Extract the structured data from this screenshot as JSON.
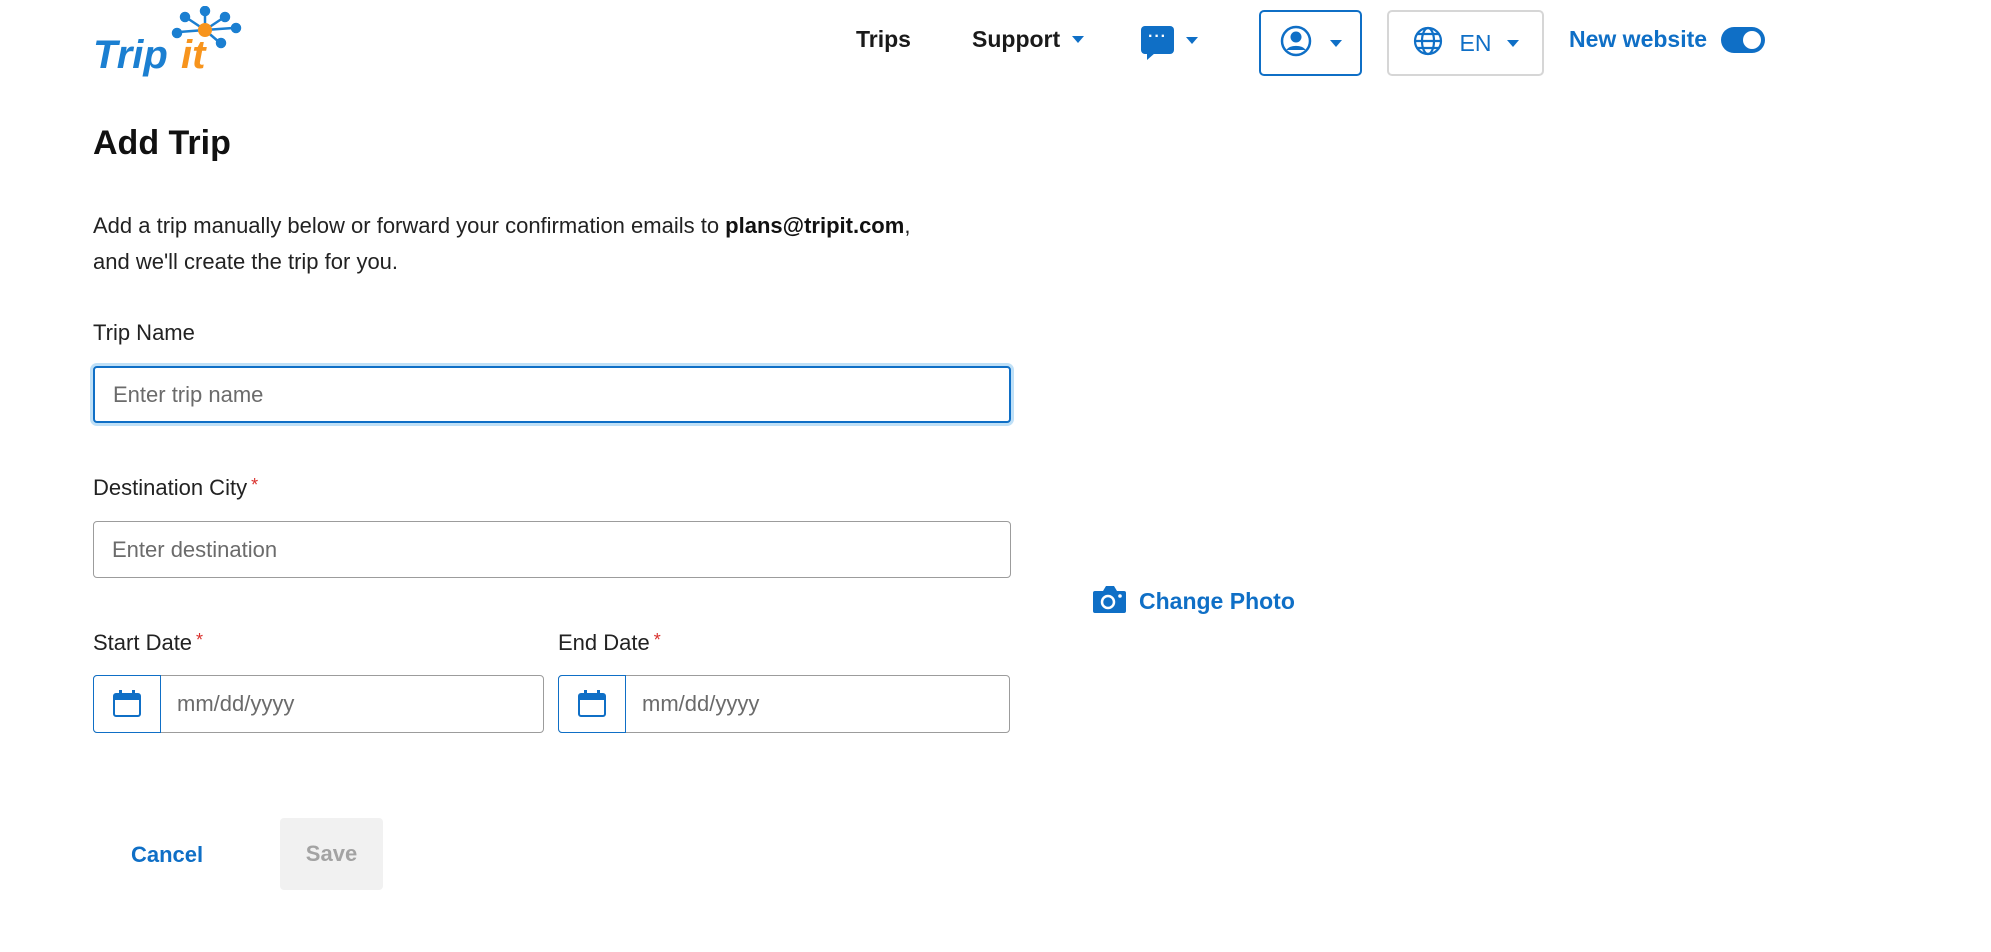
{
  "header": {
    "logo_text": "TripIt",
    "nav": {
      "trips": "Trips",
      "support": "Support"
    },
    "language": "EN",
    "new_website_label": "New website",
    "new_website_toggle_on": true
  },
  "page": {
    "title": "Add Trip",
    "intro_before": "Add a trip manually below or forward your confirmation emails to ",
    "intro_email": "plans@tripit.com",
    "intro_after": ",",
    "intro_line2": "and we'll create the trip for you."
  },
  "form": {
    "trip_name_label": "Trip Name",
    "trip_name_placeholder": "Enter trip name",
    "destination_label": "Destination City",
    "destination_placeholder": "Enter destination",
    "required_mark": "*",
    "start_date_label": "Start Date",
    "start_date_placeholder": "mm/dd/yyyy",
    "end_date_label": "End Date",
    "end_date_placeholder": "mm/dd/yyyy",
    "change_photo_label": "Change Photo",
    "cancel_label": "Cancel",
    "save_label": "Save"
  },
  "colors": {
    "accent": "#0f6fc6",
    "required": "#d9302c",
    "logo_orange": "#f7941d"
  }
}
